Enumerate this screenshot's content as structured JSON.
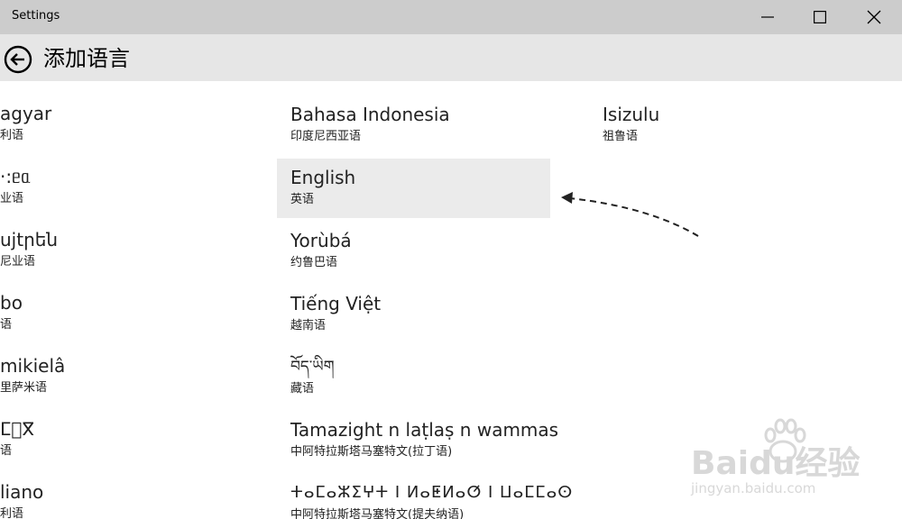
{
  "window": {
    "title": "Settings",
    "controls": {
      "minimize": "minimize-icon",
      "maximize": "maximize-icon",
      "close": "close-icon"
    }
  },
  "header": {
    "back_icon": "back-arrow-icon",
    "title": "添加语言"
  },
  "languages": {
    "column1": [
      {
        "name": "agyar",
        "sub": "利语"
      },
      {
        "name": "·:ᥱᥲ",
        "sub": "业语"
      },
      {
        "name": "ujtրեն",
        "sub": "尼业语"
      },
      {
        "name": "bo",
        "sub": "语"
      },
      {
        "name": "mikielâ",
        "sub": "里萨米语"
      },
      {
        "name": "ⵎ⵿ⴳ",
        "sub": "语"
      },
      {
        "name": "liano",
        "sub": "利语"
      }
    ],
    "column2": [
      {
        "name": "Bahasa Indonesia",
        "sub": "印度尼西亚语"
      },
      {
        "name": "English",
        "sub": "英语",
        "selected": true
      },
      {
        "name": "Yorùbá",
        "sub": "约鲁巴语"
      },
      {
        "name": "Tiếng Việt",
        "sub": "越南语"
      },
      {
        "name": "བོད་ཡིག",
        "sub": "藏语"
      },
      {
        "name": "Tamazight n laṭlaṣ n wammas",
        "sub": "中阿特拉斯塔马塞特文(拉丁语)"
      },
      {
        "name": "ⵜⴰⵎⴰⵣⵉⵖⵜ ⵏ ⵍⴰⵟⵍⴰⵚ ⵏ ⵡⴰⵎⵎⴰⵙ",
        "sub": "中阿特拉斯塔马塞特文(提夫纳语)"
      }
    ],
    "column3": [
      {
        "name": "Isizulu",
        "sub": "祖鲁语"
      }
    ]
  },
  "watermark": {
    "brand": "Baidu经验",
    "url": "jingyan.baidu.com"
  },
  "colors": {
    "titlebar": "#cccccc",
    "header": "#e6e6e6",
    "selected": "#ebebeb"
  }
}
